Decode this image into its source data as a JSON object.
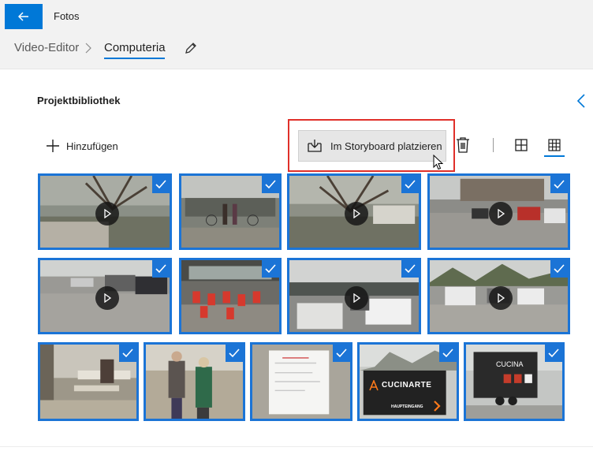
{
  "app": {
    "title": "Fotos"
  },
  "breadcrumb": {
    "root": "Video-Editor",
    "current": "Computeria"
  },
  "library": {
    "title": "Projektbibliothek",
    "add_label": "Hinzufügen",
    "place_label": "Im Storyboard platzieren"
  },
  "media": {
    "row1": [
      {
        "type": "video",
        "selected": true
      },
      {
        "type": "photo",
        "selected": true
      },
      {
        "type": "video",
        "selected": true
      },
      {
        "type": "video",
        "selected": true
      }
    ],
    "row2": [
      {
        "type": "video",
        "selected": true
      },
      {
        "type": "photo",
        "selected": true
      },
      {
        "type": "video",
        "selected": true
      },
      {
        "type": "video",
        "selected": true
      }
    ],
    "row3": [
      {
        "type": "photo",
        "selected": true
      },
      {
        "type": "photo",
        "selected": true
      },
      {
        "type": "photo",
        "selected": true
      },
      {
        "type": "photo",
        "selected": true,
        "sign_brand": "CUCINARTE",
        "sign_caption": "HAUPTEINGANG"
      },
      {
        "type": "photo",
        "selected": true,
        "trailer_brand": "CUCINA"
      }
    ]
  },
  "colors": {
    "accent": "#0078d7",
    "selection": "#1b74d6",
    "highlight": "#e0302a"
  }
}
